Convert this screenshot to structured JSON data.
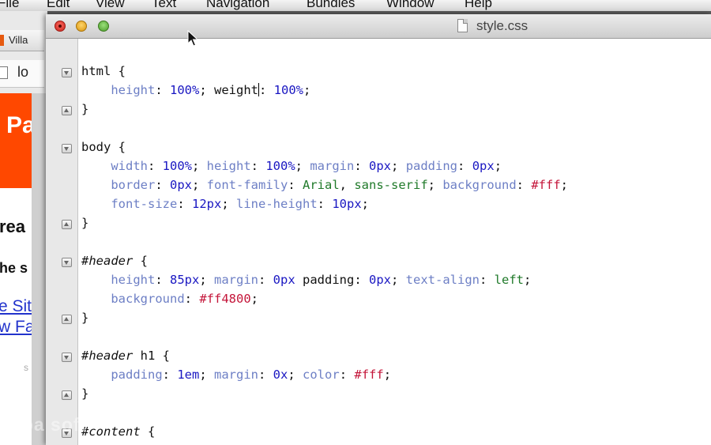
{
  "menubar": {
    "items": [
      "File",
      "Edit",
      "View",
      "Text",
      "Navigation",
      "Bundles",
      "Window",
      "Help"
    ]
  },
  "browser": {
    "tab_label": "Villa",
    "url_fragment": "lo",
    "header_text": "Pa",
    "content": {
      "line1": "rea",
      "line2": "he s",
      "link1": "e Sit",
      "link2": "w Fa",
      "faded": "s"
    }
  },
  "editor": {
    "window_title": "style.css",
    "code_lines": [
      "html {",
      "    height: 100%; weight: 100%;",
      "}",
      "",
      "body {",
      "    width: 100%; height: 100%; margin: 0px; padding: 0px;",
      "    border: 0px; font-family: Arial, sans-serif; background: #fff;",
      "    font-size: 12px; line-height: 10px;",
      "}",
      "",
      "#header {",
      "    height: 85px; margin: 0px padding: 0px; text-align: left;",
      "    background: #ff4800;",
      "}",
      "",
      "#header h1 {",
      "    padding: 1em; margin: 0x; color: #fff;",
      "}",
      "",
      "#content {"
    ]
  },
  "watermark": "apa        soft",
  "colors": {
    "property": "#6d7fc5",
    "number": "#1a17c2",
    "hex_value": "#c4163a",
    "keyword": "#207a2a",
    "accent_header": "#ff4800"
  },
  "icons": [
    "close-icon",
    "minimize-icon",
    "zoom-icon",
    "document-icon",
    "fold-open-icon",
    "fold-close-icon",
    "mouse-pointer-icon"
  ]
}
